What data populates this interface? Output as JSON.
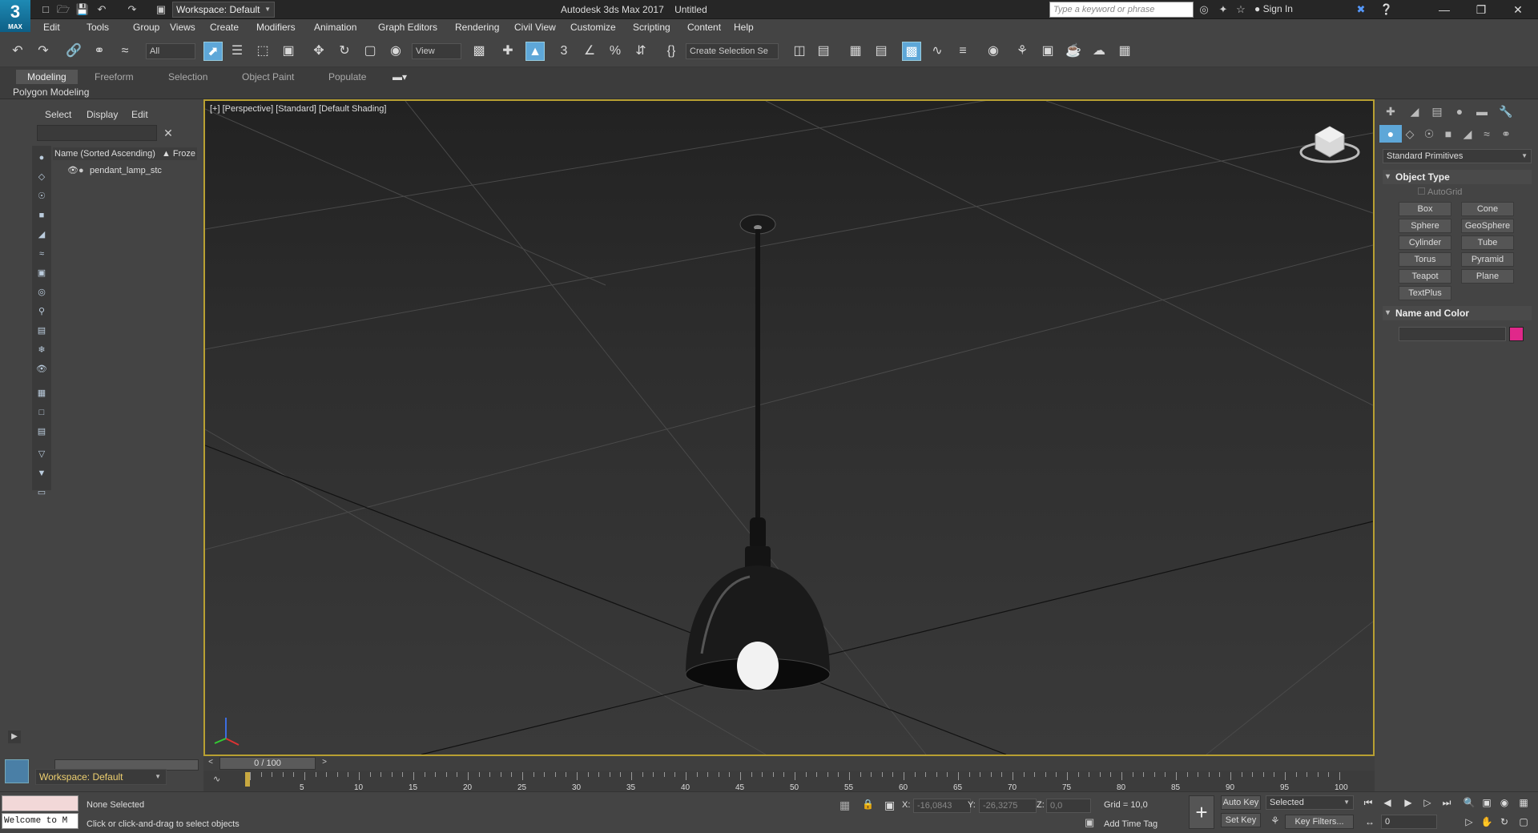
{
  "titlebar": {
    "workspace": "Workspace: Default",
    "app_title": "Autodesk 3ds Max 2017",
    "doc_title": "Untitled",
    "search_placeholder": "Type a keyword or phrase",
    "sign_in": "Sign In",
    "logo_num": "3",
    "logo_text": "MAX"
  },
  "menu": [
    "Edit",
    "Tools",
    "Group",
    "Views",
    "Create",
    "Modifiers",
    "Animation",
    "Graph Editors",
    "Rendering",
    "Civil View",
    "Customize",
    "Scripting",
    "Content",
    "Help"
  ],
  "toolbar": {
    "filter_value": "All",
    "view_value": "View",
    "selection_set": "Create Selection Se"
  },
  "ribbon": {
    "tabs": [
      "Modeling",
      "Freeform",
      "Selection",
      "Object Paint",
      "Populate"
    ],
    "sub": "Polygon Modeling"
  },
  "scene_explorer": {
    "tabs": [
      "Select",
      "Display",
      "Edit"
    ],
    "column_name": "Name (Sorted Ascending)",
    "column_frozen": "▲ Froze",
    "objects": [
      "pendant_lamp_stc"
    ],
    "workspace": "Workspace: Default"
  },
  "viewport": {
    "label": "[+] [Perspective] [Standard] [Default Shading]"
  },
  "command_panel": {
    "category": "Standard Primitives",
    "object_type_title": "Object Type",
    "autogrid": "AutoGrid",
    "buttons": [
      "Box",
      "Cone",
      "Sphere",
      "GeoSphere",
      "Cylinder",
      "Tube",
      "Torus",
      "Pyramid",
      "Teapot",
      "Plane",
      "TextPlus"
    ],
    "name_color_title": "Name and Color",
    "swatch_color": "#e0288a"
  },
  "timeline": {
    "frame_display": "0 / 100",
    "ticks": [
      "5",
      "10",
      "15",
      "20",
      "25",
      "30",
      "35",
      "40",
      "45",
      "50",
      "55",
      "60",
      "65",
      "70",
      "75",
      "80",
      "85",
      "90",
      "95",
      "100"
    ]
  },
  "status": {
    "welcome": "Welcome to M",
    "selection": "None Selected",
    "prompt": "Click or click-and-drag to select objects",
    "x_label": "X:",
    "x_value": "-16,0843",
    "y_label": "Y:",
    "y_value": "-26,3275",
    "z_label": "Z:",
    "z_value": "0,0",
    "grid": "Grid = 10,0",
    "add_time_tag": "Add Time Tag",
    "auto_key": "Auto Key",
    "set_key": "Set Key",
    "selected": "Selected",
    "key_filters": "Key Filters...",
    "frame": "0"
  }
}
